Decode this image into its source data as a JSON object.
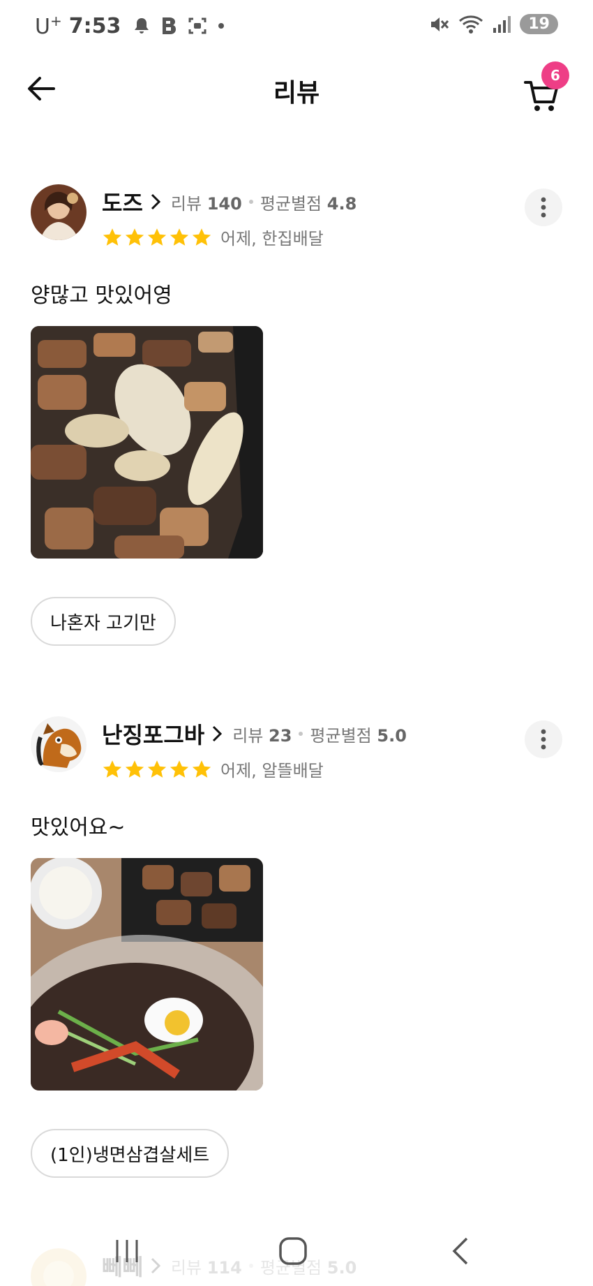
{
  "status_bar": {
    "carrier": "U",
    "carrier_sup": "+",
    "time": "7:53",
    "battery": "19"
  },
  "header": {
    "title": "리뷰",
    "cart_count": "6"
  },
  "reviews": [
    {
      "user": "도즈",
      "review_label": "리뷰",
      "review_count": "140",
      "avg_label": "평균별점",
      "avg_score": "4.8",
      "rating": 5,
      "date_type": "어제, 한집배달",
      "text": "양많고 맛있어영",
      "menu": "나혼자 고기만"
    },
    {
      "user": "난징포그바",
      "review_label": "리뷰",
      "review_count": "23",
      "avg_label": "평균별점",
      "avg_score": "5.0",
      "rating": 5,
      "date_type": "어제, 알뜰배달",
      "text": "맛있어요~",
      "menu": "(1인)냉면삼겹살세트"
    },
    {
      "user": "뻬뻬",
      "review_label": "리뷰",
      "review_count": "114",
      "avg_label": "평균별점",
      "avg_score": "5.0"
    }
  ],
  "colors": {
    "star": "#ffc107",
    "badge": "#ee3e86"
  },
  "icons": {
    "back": "arrow-left-icon",
    "cart": "cart-icon",
    "more": "more-vertical-icon",
    "star": "star-icon"
  }
}
